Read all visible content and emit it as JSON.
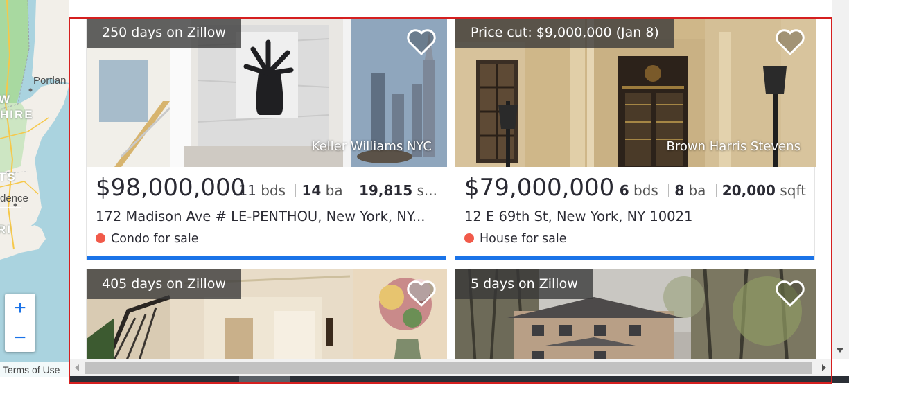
{
  "map": {
    "labels": {
      "city": "Portlan",
      "state_top": "HIRE",
      "state_bottom": "TS",
      "providence": "dence",
      "ri": "RI",
      "w": "W"
    },
    "zoom_in": "+",
    "zoom_out": "−",
    "terms": "Terms of Use"
  },
  "listings": [
    {
      "badge": "250 days on Zillow",
      "agent": "Keller Williams NYC",
      "price": "$98,000,000",
      "beds": "11",
      "beds_unit": "bds",
      "baths": "14",
      "baths_unit": "ba",
      "sqft": "19,815",
      "sqft_unit": "s...",
      "address": "172 Madison Ave # LE-PENTHOU, New York, NY...",
      "status": "Condo for sale"
    },
    {
      "badge": "Price cut: $9,000,000 (Jan 8)",
      "agent": "Brown Harris Stevens",
      "price": "$79,000,000",
      "beds": "6",
      "beds_unit": "bds",
      "baths": "8",
      "baths_unit": "ba",
      "sqft": "20,000",
      "sqft_unit": "sqft",
      "address": "12 E 69th St, New York, NY 10021",
      "status": "House for sale"
    },
    {
      "badge": "405 days on Zillow"
    },
    {
      "badge": "5 days on Zillow"
    }
  ],
  "colors": {
    "accent": "#1a73e8",
    "status_dot": "#f15a4a",
    "selection_outline": "#d51f1f"
  }
}
